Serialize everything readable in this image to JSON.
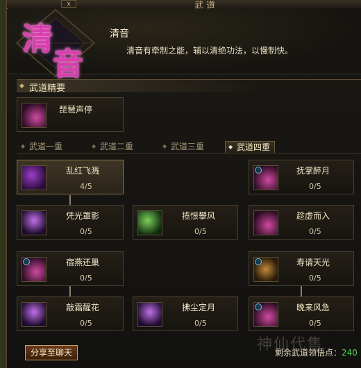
{
  "window": {
    "title": "武道",
    "close_label": "x"
  },
  "school": {
    "emblem_chars": [
      "清",
      "音"
    ],
    "name": "清音",
    "description": "清音有牵制之能，辅以清绝功法，以慢制快。"
  },
  "essentials": {
    "heading": "武道精要",
    "skill": {
      "name": "琵琶声停",
      "icon": "pipa-icon"
    }
  },
  "tabs": [
    {
      "label": "武道一重",
      "active": false
    },
    {
      "label": "武道二重",
      "active": false
    },
    {
      "label": "武道三重",
      "active": false
    },
    {
      "label": "武道四重",
      "active": true
    }
  ],
  "skills": [
    {
      "name": "乱红飞溅",
      "level": "4/5",
      "icon": "scatter-red-icon",
      "selected": true
    },
    {
      "name": "抚掌醉月",
      "level": "0/5",
      "icon": "drunk-moon-icon"
    },
    {
      "name": "凭光罩影",
      "level": "0/5",
      "icon": "light-veil-icon"
    },
    {
      "name": "揽恨攀风",
      "level": "0/5",
      "icon": "wind-climb-icon"
    },
    {
      "name": "趁虚而入",
      "level": "0/5",
      "icon": "exploit-icon"
    },
    {
      "name": "宿燕还巢",
      "level": "0/5",
      "icon": "swallow-nest-icon"
    },
    {
      "name": "寿请天光",
      "level": "0/5",
      "icon": "sky-light-icon"
    },
    {
      "name": "敲霜醒花",
      "level": "0/5",
      "icon": "frost-flower-icon"
    },
    {
      "name": "拂尘定月",
      "level": "0/5",
      "icon": "whisk-moon-icon"
    },
    {
      "name": "晚来风急",
      "level": "0/5",
      "icon": "evening-wind-icon"
    }
  ],
  "footer": {
    "share_label": "分享至聊天",
    "points_label": "剩余武道领悟点：",
    "points_value": "240",
    "watermark": "神仙代售"
  }
}
